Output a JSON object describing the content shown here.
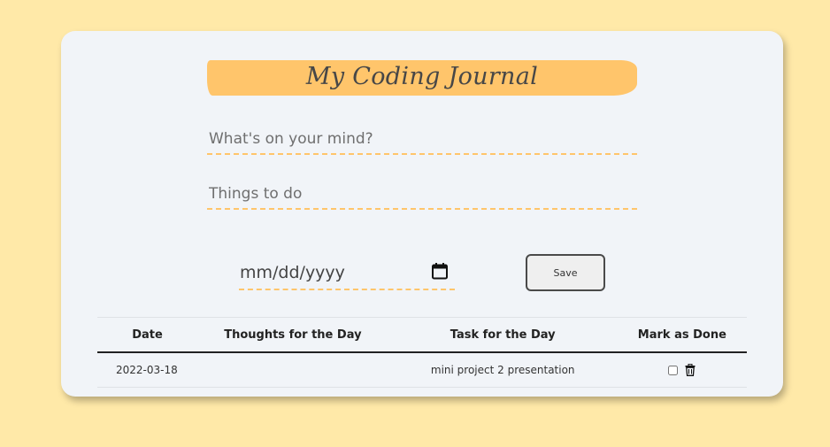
{
  "header": {
    "title": "My Coding Journal"
  },
  "form": {
    "thought_placeholder": "What's on your mind?",
    "task_placeholder": "Things to do",
    "date_placeholder": "mm/dd/yyyy",
    "save_label": "Save"
  },
  "table": {
    "headers": [
      "Date",
      "Thoughts for the Day",
      "Task for the Day",
      "Mark as Done"
    ],
    "rows": [
      {
        "date": "2022-03-18",
        "thought": "",
        "task": "mini project 2 presentation",
        "done": false
      }
    ]
  },
  "icons": {
    "date_picker": "calendar-icon",
    "delete": "trash-icon"
  },
  "colors": {
    "background": "#ffe9a8",
    "card": "#f1f4f8",
    "accent": "#ffc56b"
  }
}
